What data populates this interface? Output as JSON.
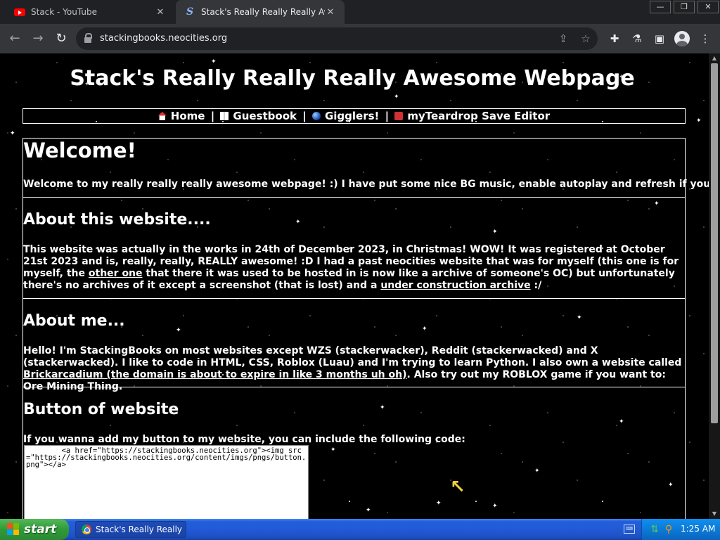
{
  "browser": {
    "tabs": [
      {
        "title": "Stack - YouTube",
        "icon": "youtube-icon",
        "active": false
      },
      {
        "title": "Stack's Really Really Really Awesome Webpage",
        "icon": "site-s-icon",
        "active": true
      }
    ],
    "url": "stackingbooks.neocities.org",
    "window_controls": {
      "minimize": "—",
      "restore": "❐",
      "close": "✕"
    }
  },
  "page": {
    "title": "Stack's Really Really Really Awesome Webpage",
    "nav": {
      "home": "Home",
      "guestbook": "Guestbook",
      "gigglers": "Gigglers!",
      "editor": "myTeardrop Save Editor",
      "separator": "|"
    },
    "welcome": {
      "heading": "Welcome!",
      "text": "Welcome to my really really really awesome webpage! :) I have put some nice BG music, enable autoplay and refresh if you want it!"
    },
    "about_site": {
      "heading": "About this website....",
      "text_1": "This website was actually in the works in 24th of December 2023, in Christmas! WOW! It was registered at October 21st 2023 and is, really, really, REALLY awesome! :D I had a past neocities website that was for myself (this one is for myself, the ",
      "link_1": "other one",
      "text_2": " that there it was used to be hosted in is now like a archive of someone's OC) but unfortunately there's no archives of it except a screenshot (that is lost) and a ",
      "link_2": "under construction archive",
      "text_3": " :/"
    },
    "about_me": {
      "heading": "About me...",
      "text_1": "Hello! I'm StackingBooks on most websites except WZS (stackerwacker), Reddit (stackerwacked) and X (stackerwacked). I like to code in HTML, CSS, Roblox (Luau) and I'm trying to learn Python. I also own a website called ",
      "link_1": "Brickarcadium (the domain is about to expire in like 3 months uh oh)",
      "text_2": ". Also try out my ROBLOX game if you want to: Ore Mining Thing."
    },
    "button_section": {
      "heading": "Button of website",
      "text": "If you wanna add my button to my website, you can include the following code:",
      "code": "        <a href=\"https://stackingbooks.neocities.org\"><img src=\"https://stackingbooks.neocities.org/content/imgs/pngs/button.png\"></a>"
    }
  },
  "taskbar": {
    "start_label": "start",
    "window_item": "Stack's Really Really ...",
    "clock": "1:25 AM"
  },
  "colors": {
    "page_background": "#000000",
    "page_text": "#ffffff",
    "taskbar_blue": "#245edb",
    "start_green": "#2f9a37"
  }
}
